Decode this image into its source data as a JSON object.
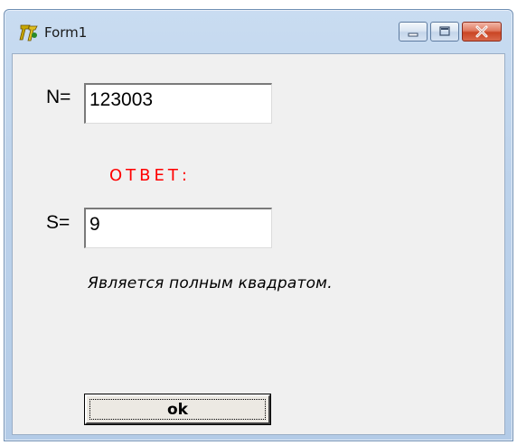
{
  "window": {
    "title": "Form1",
    "icons": {
      "app": "delphi-app-icon",
      "minimize": "minimize-icon",
      "maximize": "maximize-icon",
      "close": "close-icon"
    },
    "colors": {
      "answer_label": "#ff0000",
      "close_button": "#c94524"
    }
  },
  "form": {
    "n_label": "N=",
    "n_value": "123003",
    "answer_label": "ОТВЕТ:",
    "s_label": "S=",
    "s_value": "9",
    "result_text": "Является полным квадратом.",
    "ok_label": "ok"
  }
}
